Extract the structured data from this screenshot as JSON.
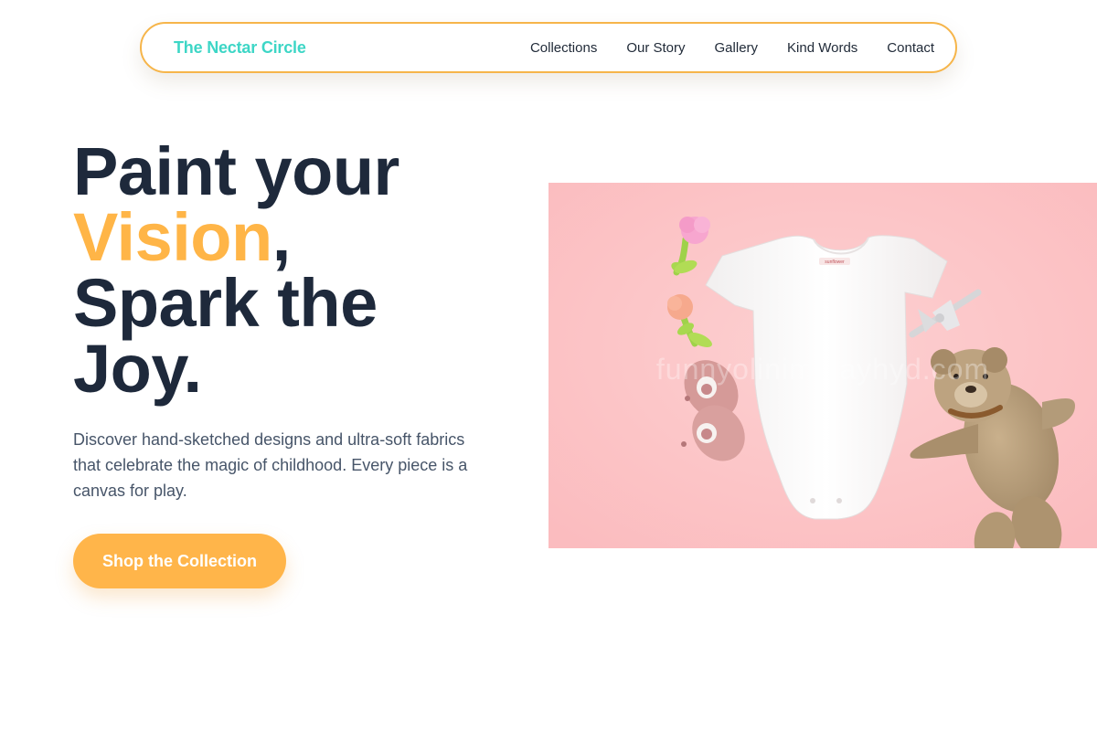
{
  "brand": {
    "name": "The Nectar Circle"
  },
  "nav": {
    "links": [
      {
        "label": "Collections"
      },
      {
        "label": "Our Story"
      },
      {
        "label": "Gallery"
      },
      {
        "label": "Kind Words"
      },
      {
        "label": "Contact"
      }
    ]
  },
  "hero": {
    "title_line1": "Paint your",
    "title_accent": "Vision",
    "title_comma": ",",
    "title_line3": "Spark the",
    "title_line4": "Joy.",
    "description": "Discover hand-sketched designs and ultra-soft fabrics that celebrate the magic of childhood. Every piece is a canvas for play.",
    "cta_label": "Shop the Collection",
    "image": {
      "watermark": "funnyolinimmayhyd.com",
      "onesie_tag": "sunflower"
    }
  },
  "colors": {
    "accent": "#ffb547",
    "brand": "#3dd6c6",
    "text_dark": "#1e293b",
    "text_body": "#475569",
    "nav_border": "#f6b54a",
    "image_background": "#fdc6c8"
  }
}
